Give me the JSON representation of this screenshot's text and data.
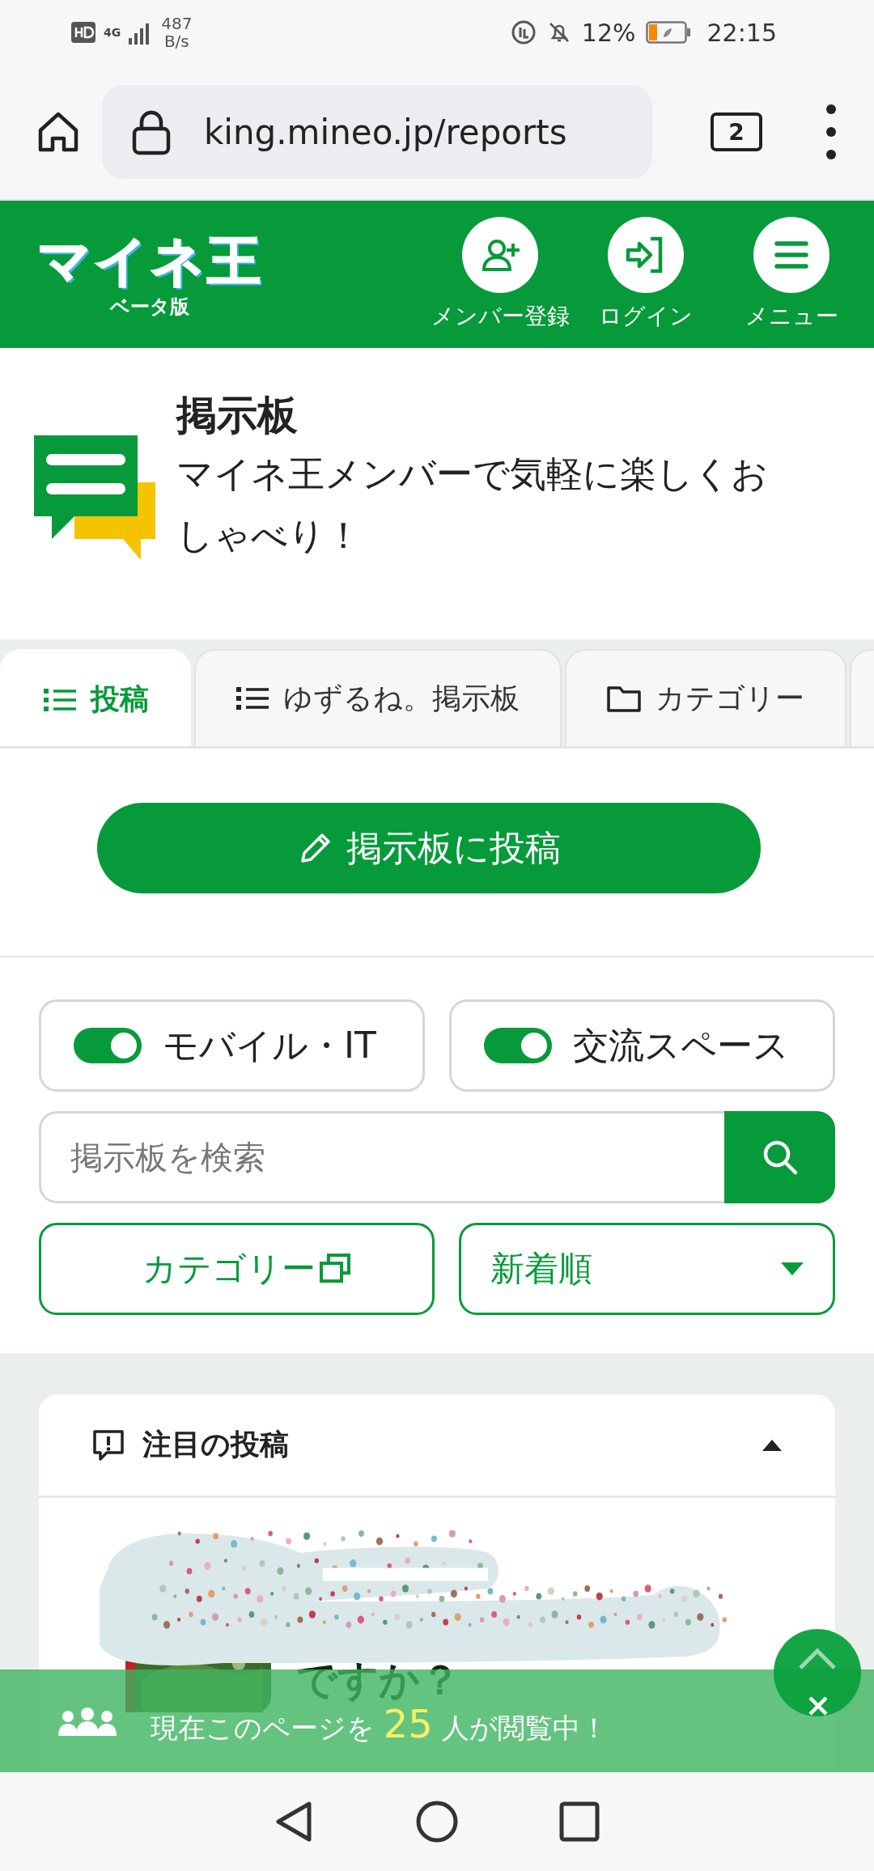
{
  "status_bar": {
    "network": "4G",
    "speed": "487",
    "speed_unit": "B/s",
    "battery": "12%",
    "time": "22:15"
  },
  "browser": {
    "url": "king.mineo.jp/reports",
    "tab_count": "2"
  },
  "header": {
    "logo": "マイネ王",
    "logo_sub": "ベータ版",
    "actions": [
      {
        "kind": "register",
        "label": "メンバー登録"
      },
      {
        "kind": "login",
        "label": "ログイン"
      },
      {
        "kind": "menu",
        "label": "メニュー"
      }
    ]
  },
  "hero": {
    "title": "掲示板",
    "subtitle": "マイネ王メンバーで気軽に楽しくおしゃべり！"
  },
  "tabs": [
    {
      "kind": "list",
      "label": "投稿",
      "selected": true
    },
    {
      "kind": "list",
      "label": "ゆずるね。掲示板",
      "selected": false
    },
    {
      "kind": "folder",
      "label": "カテゴリー",
      "selected": false
    }
  ],
  "post_button": "掲示板に投稿",
  "toggles": [
    {
      "label": "モバイル・IT",
      "on": true
    },
    {
      "label": "交流スペース",
      "on": true
    }
  ],
  "search": {
    "placeholder": "掲示板を検索"
  },
  "category_button": "カテゴリー",
  "sort": {
    "value": "新着順"
  },
  "featured": {
    "title": "注目の投稿",
    "expanded": true,
    "post_title": "ですか？"
  },
  "viewer_banner": {
    "before": "現在このページを",
    "count": "25",
    "after": "人が閲覧中！"
  }
}
